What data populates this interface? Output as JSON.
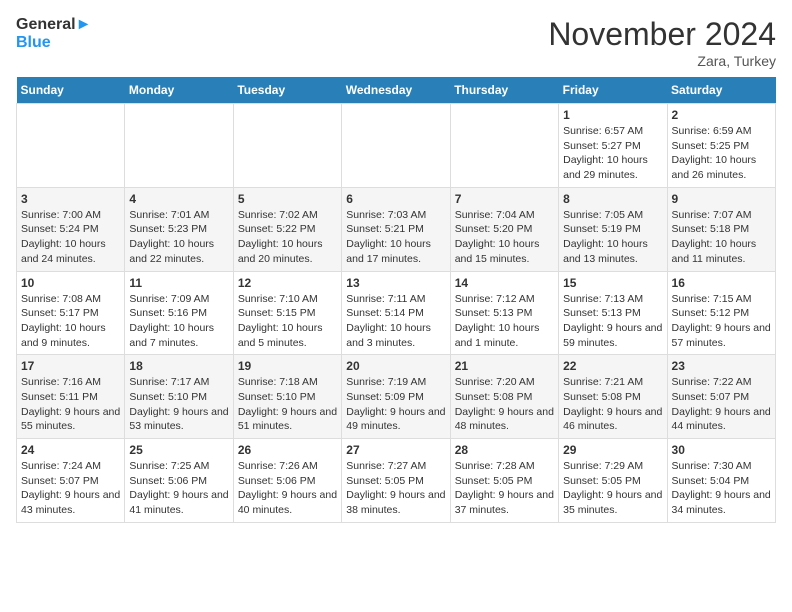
{
  "header": {
    "logo_line1": "General",
    "logo_line2": "Blue",
    "month": "November 2024",
    "location": "Zara, Turkey"
  },
  "weekdays": [
    "Sunday",
    "Monday",
    "Tuesday",
    "Wednesday",
    "Thursday",
    "Friday",
    "Saturday"
  ],
  "weeks": [
    [
      {
        "day": "",
        "info": ""
      },
      {
        "day": "",
        "info": ""
      },
      {
        "day": "",
        "info": ""
      },
      {
        "day": "",
        "info": ""
      },
      {
        "day": "",
        "info": ""
      },
      {
        "day": "1",
        "info": "Sunrise: 6:57 AM\nSunset: 5:27 PM\nDaylight: 10 hours and 29 minutes."
      },
      {
        "day": "2",
        "info": "Sunrise: 6:59 AM\nSunset: 5:25 PM\nDaylight: 10 hours and 26 minutes."
      }
    ],
    [
      {
        "day": "3",
        "info": "Sunrise: 7:00 AM\nSunset: 5:24 PM\nDaylight: 10 hours and 24 minutes."
      },
      {
        "day": "4",
        "info": "Sunrise: 7:01 AM\nSunset: 5:23 PM\nDaylight: 10 hours and 22 minutes."
      },
      {
        "day": "5",
        "info": "Sunrise: 7:02 AM\nSunset: 5:22 PM\nDaylight: 10 hours and 20 minutes."
      },
      {
        "day": "6",
        "info": "Sunrise: 7:03 AM\nSunset: 5:21 PM\nDaylight: 10 hours and 17 minutes."
      },
      {
        "day": "7",
        "info": "Sunrise: 7:04 AM\nSunset: 5:20 PM\nDaylight: 10 hours and 15 minutes."
      },
      {
        "day": "8",
        "info": "Sunrise: 7:05 AM\nSunset: 5:19 PM\nDaylight: 10 hours and 13 minutes."
      },
      {
        "day": "9",
        "info": "Sunrise: 7:07 AM\nSunset: 5:18 PM\nDaylight: 10 hours and 11 minutes."
      }
    ],
    [
      {
        "day": "10",
        "info": "Sunrise: 7:08 AM\nSunset: 5:17 PM\nDaylight: 10 hours and 9 minutes."
      },
      {
        "day": "11",
        "info": "Sunrise: 7:09 AM\nSunset: 5:16 PM\nDaylight: 10 hours and 7 minutes."
      },
      {
        "day": "12",
        "info": "Sunrise: 7:10 AM\nSunset: 5:15 PM\nDaylight: 10 hours and 5 minutes."
      },
      {
        "day": "13",
        "info": "Sunrise: 7:11 AM\nSunset: 5:14 PM\nDaylight: 10 hours and 3 minutes."
      },
      {
        "day": "14",
        "info": "Sunrise: 7:12 AM\nSunset: 5:13 PM\nDaylight: 10 hours and 1 minute."
      },
      {
        "day": "15",
        "info": "Sunrise: 7:13 AM\nSunset: 5:13 PM\nDaylight: 9 hours and 59 minutes."
      },
      {
        "day": "16",
        "info": "Sunrise: 7:15 AM\nSunset: 5:12 PM\nDaylight: 9 hours and 57 minutes."
      }
    ],
    [
      {
        "day": "17",
        "info": "Sunrise: 7:16 AM\nSunset: 5:11 PM\nDaylight: 9 hours and 55 minutes."
      },
      {
        "day": "18",
        "info": "Sunrise: 7:17 AM\nSunset: 5:10 PM\nDaylight: 9 hours and 53 minutes."
      },
      {
        "day": "19",
        "info": "Sunrise: 7:18 AM\nSunset: 5:10 PM\nDaylight: 9 hours and 51 minutes."
      },
      {
        "day": "20",
        "info": "Sunrise: 7:19 AM\nSunset: 5:09 PM\nDaylight: 9 hours and 49 minutes."
      },
      {
        "day": "21",
        "info": "Sunrise: 7:20 AM\nSunset: 5:08 PM\nDaylight: 9 hours and 48 minutes."
      },
      {
        "day": "22",
        "info": "Sunrise: 7:21 AM\nSunset: 5:08 PM\nDaylight: 9 hours and 46 minutes."
      },
      {
        "day": "23",
        "info": "Sunrise: 7:22 AM\nSunset: 5:07 PM\nDaylight: 9 hours and 44 minutes."
      }
    ],
    [
      {
        "day": "24",
        "info": "Sunrise: 7:24 AM\nSunset: 5:07 PM\nDaylight: 9 hours and 43 minutes."
      },
      {
        "day": "25",
        "info": "Sunrise: 7:25 AM\nSunset: 5:06 PM\nDaylight: 9 hours and 41 minutes."
      },
      {
        "day": "26",
        "info": "Sunrise: 7:26 AM\nSunset: 5:06 PM\nDaylight: 9 hours and 40 minutes."
      },
      {
        "day": "27",
        "info": "Sunrise: 7:27 AM\nSunset: 5:05 PM\nDaylight: 9 hours and 38 minutes."
      },
      {
        "day": "28",
        "info": "Sunrise: 7:28 AM\nSunset: 5:05 PM\nDaylight: 9 hours and 37 minutes."
      },
      {
        "day": "29",
        "info": "Sunrise: 7:29 AM\nSunset: 5:05 PM\nDaylight: 9 hours and 35 minutes."
      },
      {
        "day": "30",
        "info": "Sunrise: 7:30 AM\nSunset: 5:04 PM\nDaylight: 9 hours and 34 minutes."
      }
    ]
  ]
}
